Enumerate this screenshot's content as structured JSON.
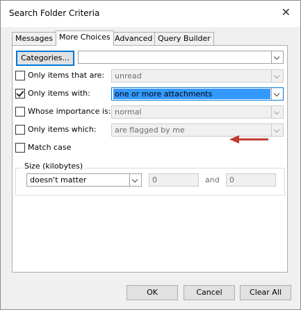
{
  "window": {
    "title": "Search Folder Criteria",
    "close_glyph": "✕"
  },
  "tabs": [
    {
      "label": "Messages"
    },
    {
      "label": "More Choices"
    },
    {
      "label": "Advanced"
    },
    {
      "label": "Query Builder"
    }
  ],
  "categories": {
    "button_label": "Categories...",
    "value": ""
  },
  "criteria": {
    "only_items_that_are": {
      "label": "Only items that are:",
      "checked": false,
      "value": "unread"
    },
    "only_items_with": {
      "label": "Only items with:",
      "checked": true,
      "value": "one or more attachments"
    },
    "whose_importance_is": {
      "label": "Whose importance is:",
      "checked": false,
      "value": "normal"
    },
    "only_items_which": {
      "label": "Only items which:",
      "checked": false,
      "value": "are flagged by me"
    },
    "match_case": {
      "label": "Match case",
      "checked": false
    }
  },
  "size": {
    "group_label": "Size (kilobytes)",
    "condition": "doesn't matter",
    "min": "0",
    "and_label": "and",
    "max": "0"
  },
  "buttons": {
    "ok": "OK",
    "cancel": "Cancel",
    "clear_all": "Clear All"
  },
  "colors": {
    "selection": "#3399ff",
    "annotation_arrow": "#c0392b"
  }
}
